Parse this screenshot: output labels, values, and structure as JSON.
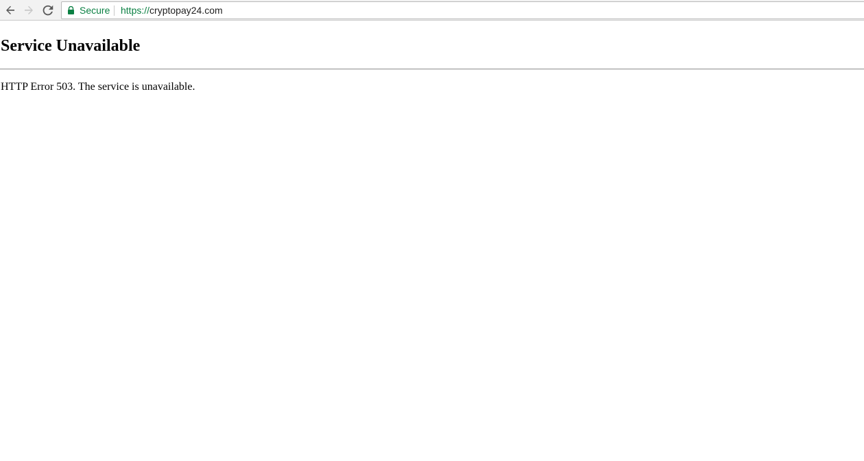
{
  "browser": {
    "security_label": "Secure",
    "url_scheme": "https://",
    "url_host": "cryptopay24.com",
    "colors": {
      "secure": "#0b8043",
      "icon": "#5a5a5a",
      "icon_disabled": "#c8c8c8"
    },
    "icons": [
      "back-arrow-icon",
      "forward-arrow-icon",
      "reload-icon",
      "lock-icon"
    ]
  },
  "page": {
    "title": "Service Unavailable",
    "message": "HTTP Error 503. The service is unavailable."
  }
}
